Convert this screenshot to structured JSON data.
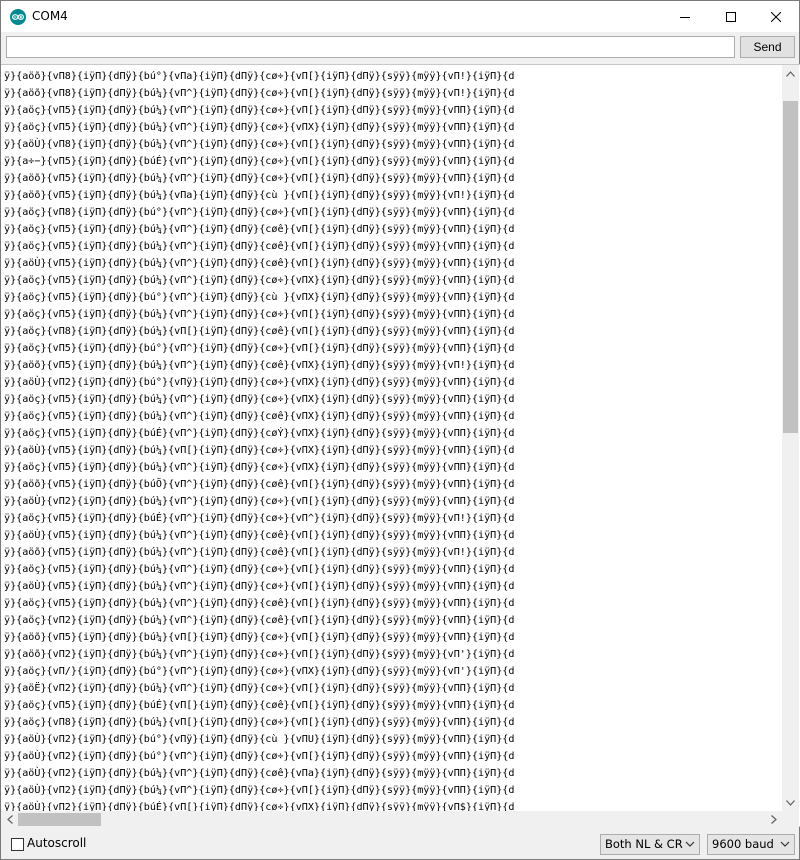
{
  "window": {
    "title": "COM4",
    "app_icon": "arduino-logo-icon",
    "controls": [
      "minimize-icon",
      "maximize-icon",
      "close-icon"
    ]
  },
  "send_bar": {
    "input_value": "",
    "send_label": "Send"
  },
  "output": {
    "lines": [
      "ÿ}{aöõ}{vΠ8}{iÿΠ}{dΠÿ}{bú°}{vΠa}{iÿΠ}{dΠÿ}{cø÷}{vΠ[}{iÿΠ}{dΠÿ}{sÿÿ}{mÿÿ}{vΠ!}{iÿΠ}{d",
      "ÿ}{aöõ}{vΠ8}{iÿΠ}{dΠÿ}{bú¼}{vΠ^}{iÿΠ}{dΠÿ}{cø÷}{vΠ[}{iÿΠ}{dΠÿ}{sÿÿ}{mÿÿ}{vΠ!}{iÿΠ}{d",
      "ÿ}{aöç}{vΠ5}{iÿΠ}{dΠÿ}{bú¼}{vΠ^}{iÿΠ}{dΠÿ}{cø÷}{vΠ[}{iÿΠ}{dΠÿ}{sÿÿ}{mÿÿ}{vΠΠ}{iÿΠ}{d",
      "ÿ}{aöç}{vΠ5}{iÿΠ}{dΠÿ}{bú¼}{vΠ^}{iÿΠ}{dΠÿ}{cø÷}{vΠX}{iÿΠ}{dΠÿ}{sÿÿ}{mÿÿ}{vΠΠ}{iÿΠ}{d",
      "ÿ}{aöÙ}{vΠ8}{iÿΠ}{dΠÿ}{bú¼}{vΠ^}{iÿΠ}{dΠÿ}{cø÷}{vΠ[}{iÿΠ}{dΠÿ}{sÿÿ}{mÿÿ}{vΠΠ}{iÿΠ}{d",
      "ÿ}{a÷−}{vΠ5}{iÿΠ}{dΠÿ}{búÉ}{vΠ^}{iÿΠ}{dΠÿ}{cø÷}{vΠ[}{iÿΠ}{dΠÿ}{sÿÿ}{mÿÿ}{vΠΠ}{iÿΠ}{d",
      "ÿ}{aöõ}{vΠ5}{iÿΠ}{dΠÿ}{bú¼}{vΠ^}{iÿΠ}{dΠÿ}{cø÷}{vΠ[}{iÿΠ}{dΠÿ}{sÿÿ}{mÿÿ}{vΠΠ}{iÿΠ}{d",
      "ÿ}{aöõ}{vΠ5}{iÿΠ}{dΠÿ}{bú¼}{vΠa}{iÿΠ}{dΠÿ}{cù }{vΠ[}{iÿΠ}{dΠÿ}{sÿÿ}{mÿÿ}{vΠ!}{iÿΠ}{d",
      "ÿ}{aöç}{vΠ8}{iÿΠ}{dΠÿ}{bú°}{vΠ^}{iÿΠ}{dΠÿ}{cø÷}{vΠ[}{iÿΠ}{dΠÿ}{sÿÿ}{mÿÿ}{vΠΠ}{iÿΠ}{d",
      "ÿ}{aöç}{vΠ5}{iÿΠ}{dΠÿ}{bú¼}{vΠ^}{iÿΠ}{dΠÿ}{cøê}{vΠ[}{iÿΠ}{dΠÿ}{sÿÿ}{mÿÿ}{vΠΠ}{iÿΠ}{d",
      "ÿ}{aöç}{vΠ5}{iÿΠ}{dΠÿ}{bú¼}{vΠ^}{iÿΠ}{dΠÿ}{cøê}{vΠ[}{iÿΠ}{dΠÿ}{sÿÿ}{mÿÿ}{vΠΠ}{iÿΠ}{d",
      "ÿ}{aöÙ}{vΠ5}{iÿΠ}{dΠÿ}{bú¼}{vΠ^}{iÿΠ}{dΠÿ}{cøê}{vΠ[}{iÿΠ}{dΠÿ}{sÿÿ}{mÿÿ}{vΠΠ}{iÿΠ}{d",
      "ÿ}{aöç}{vΠ5}{iÿΠ}{dΠÿ}{bú¼}{vΠ^}{iÿΠ}{dΠÿ}{cø÷}{vΠX}{iÿΠ}{dΠÿ}{sÿÿ}{mÿÿ}{vΠΠ}{iÿΠ}{d",
      "ÿ}{aöç}{vΠ5}{iÿΠ}{dΠÿ}{bú°}{vΠ^}{iÿΠ}{dΠÿ}{cù }{vΠX}{iÿΠ}{dΠÿ}{sÿÿ}{mÿÿ}{vΠΠ}{iÿΠ}{d",
      "ÿ}{aöç}{vΠ5}{iÿΠ}{dΠÿ}{bú¼}{vΠ^}{iÿΠ}{dΠÿ}{cø÷}{vΠ[}{iÿΠ}{dΠÿ}{sÿÿ}{mÿÿ}{vΠΠ}{iÿΠ}{d",
      "ÿ}{aöç}{vΠ8}{iÿΠ}{dΠÿ}{bú¼}{vΠ[}{iÿΠ}{dΠÿ}{cøê}{vΠ[}{iÿΠ}{dΠÿ}{sÿÿ}{mÿÿ}{vΠΠ}{iÿΠ}{d",
      "ÿ}{aöç}{vΠ5}{iÿΠ}{dΠÿ}{bú°}{vΠ^}{iÿΠ}{dΠÿ}{cø÷}{vΠ[}{iÿΠ}{dΠÿ}{sÿÿ}{mÿÿ}{vΠΠ}{iÿΠ}{d",
      "ÿ}{aöõ}{vΠ5}{iÿΠ}{dΠÿ}{bú¼}{vΠ^}{iÿΠ}{dΠÿ}{cøê}{vΠX}{iÿΠ}{dΠÿ}{sÿÿ}{mÿÿ}{vΠ!}{iÿΠ}{d",
      "ÿ}{aöÙ}{vΠ2}{iÿΠ}{dΠÿ}{bú°}{vΠÿ}{iÿΠ}{dΠÿ}{cø÷}{vΠX}{iÿΠ}{dΠÿ}{sÿÿ}{mÿÿ}{vΠΠ}{iÿΠ}{d",
      "ÿ}{aöç}{vΠ5}{iÿΠ}{dΠÿ}{bú¼}{vΠ^}{iÿΠ}{dΠÿ}{cø÷}{vΠX}{iÿΠ}{dΠÿ}{sÿÿ}{mÿÿ}{vΠΠ}{iÿΠ}{d",
      "ÿ}{aöç}{vΠ5}{iÿΠ}{dΠÿ}{bú¼}{vΠ^}{iÿΠ}{dΠÿ}{cøê}{vΠX}{iÿΠ}{dΠÿ}{sÿÿ}{mÿÿ}{vΠΠ}{iÿΠ}{d",
      "ÿ}{aöç}{vΠ5}{iÿΠ}{dΠÿ}{búÉ}{vΠ^}{iÿΠ}{dΠÿ}{cøÝ}{vΠX}{iÿΠ}{dΠÿ}{sÿÿ}{mÿÿ}{vΠΠ}{iÿΠ}{d",
      "ÿ}{aöÙ}{vΠ5}{iÿΠ}{dΠÿ}{bú¼}{vΠ[}{iÿΠ}{dΠÿ}{cø÷}{vΠX}{iÿΠ}{dΠÿ}{sÿÿ}{mÿÿ}{vΠΠ}{iÿΠ}{d",
      "ÿ}{aöç}{vΠ5}{iÿΠ}{dΠÿ}{bú¼}{vΠ^}{iÿΠ}{dΠÿ}{cø÷}{vΠX}{iÿΠ}{dΠÿ}{sÿÿ}{mÿÿ}{vΠΠ}{iÿΠ}{d",
      "ÿ}{aöõ}{vΠ5}{iÿΠ}{dΠÿ}{búÕ}{vΠ^}{iÿΠ}{dΠÿ}{cøê}{vΠ[}{iÿΠ}{dΠÿ}{sÿÿ}{mÿÿ}{vΠΠ}{iÿΠ}{d",
      "ÿ}{aöÙ}{vΠ2}{iÿΠ}{dΠÿ}{bú¼}{vΠ^}{iÿΠ}{dΠÿ}{cø÷}{vΠ[}{iÿΠ}{dΠÿ}{sÿÿ}{mÿÿ}{vΠΠ}{iÿΠ}{d",
      "ÿ}{aöç}{vΠ5}{iÿΠ}{dΠÿ}{búÉ}{vΠ^}{iÿΠ}{dΠÿ}{cø÷}{vΠ^}{iÿΠ}{dΠÿ}{sÿÿ}{mÿÿ}{vΠ!}{iÿΠ}{d",
      "ÿ}{aöÙ}{vΠ5}{iÿΠ}{dΠÿ}{bú¼}{vΠ^}{iÿΠ}{dΠÿ}{cøê}{vΠ[}{iÿΠ}{dΠÿ}{sÿÿ}{mÿÿ}{vΠΠ}{iÿΠ}{d",
      "ÿ}{aöõ}{vΠ5}{iÿΠ}{dΠÿ}{bú¼}{vΠ^}{iÿΠ}{dΠÿ}{cøê}{vΠ[}{iÿΠ}{dΠÿ}{sÿÿ}{mÿÿ}{vΠ!}{iÿΠ}{d",
      "ÿ}{aöç}{vΠ5}{iÿΠ}{dΠÿ}{bú¼}{vΠ^}{iÿΠ}{dΠÿ}{cø÷}{vΠ[}{iÿΠ}{dΠÿ}{sÿÿ}{mÿÿ}{vΠΠ}{iÿΠ}{d",
      "ÿ}{aöÙ}{vΠ5}{iÿΠ}{dΠÿ}{bú¼}{vΠ^}{iÿΠ}{dΠÿ}{cø÷}{vΠ[}{iÿΠ}{dΠÿ}{sÿÿ}{mÿÿ}{vΠΠ}{iÿΠ}{d",
      "ÿ}{aöç}{vΠ5}{iÿΠ}{dΠÿ}{bú¼}{vΠ^}{iÿΠ}{dΠÿ}{cøê}{vΠ[}{iÿΠ}{dΠÿ}{sÿÿ}{mÿÿ}{vΠΠ}{iÿΠ}{d",
      "ÿ}{aöç}{vΠ2}{iÿΠ}{dΠÿ}{bú¼}{vΠ^}{iÿΠ}{dΠÿ}{cøê}{vΠ[}{iÿΠ}{dΠÿ}{sÿÿ}{mÿÿ}{vΠΠ}{iÿΠ}{d",
      "ÿ}{aöõ}{vΠ5}{iÿΠ}{dΠÿ}{bú¼}{vΠ[}{iÿΠ}{dΠÿ}{cø÷}{vΠ[}{iÿΠ}{dΠÿ}{sÿÿ}{mÿÿ}{vΠΠ}{iÿΠ}{d",
      "ÿ}{aöõ}{vΠ2}{iÿΠ}{dΠÿ}{bú¼}{vΠ^}{iÿΠ}{dΠÿ}{cø÷}{vΠ[}{iÿΠ}{dΠÿ}{sÿÿ}{mÿÿ}{vΠ'}{iÿΠ}{d",
      "ÿ}{aöç}{vΠ/}{iÿΠ}{dΠÿ}{bú°}{vΠ^}{iÿΠ}{dΠÿ}{cø÷}{vΠX}{iÿΠ}{dΠÿ}{sÿÿ}{mÿÿ}{vΠ'}{iÿΠ}{d",
      "ÿ}{aöË}{vΠ2}{iÿΠ}{dΠÿ}{bú¼}{vΠ^}{iÿΠ}{dΠÿ}{cø÷}{vΠ[}{iÿΠ}{dΠÿ}{sÿÿ}{mÿÿ}{vΠΠ}{iÿΠ}{d",
      "ÿ}{aöç}{vΠ5}{iÿΠ}{dΠÿ}{búÉ}{vΠ[}{iÿΠ}{dΠÿ}{cøê}{vΠ[}{iÿΠ}{dΠÿ}{sÿÿ}{mÿÿ}{vΠΠ}{iÿΠ}{d",
      "ÿ}{aöç}{vΠ8}{iÿΠ}{dΠÿ}{bú¼}{vΠ[}{iÿΠ}{dΠÿ}{cø÷}{vΠ[}{iÿΠ}{dΠÿ}{sÿÿ}{mÿÿ}{vΠΠ}{iÿΠ}{d",
      "ÿ}{aöÙ}{vΠ2}{iÿΠ}{dΠÿ}{bú°}{vΠÿ}{iÿΠ}{dΠÿ}{cù }{vΠU}{iÿΠ}{dΠÿ}{sÿÿ}{mÿÿ}{vΠΠ}{iÿΠ}{d",
      "ÿ}{aöÙ}{vΠ2}{iÿΠ}{dΠÿ}{bú°}{vΠ^}{iÿΠ}{dΠÿ}{cø÷}{vΠ[}{iÿΠ}{dΠÿ}{sÿÿ}{mÿÿ}{vΠΠ}{iÿΠ}{d",
      "ÿ}{aöÙ}{vΠ2}{iÿΠ}{dΠÿ}{bú¼}{vΠ^}{iÿΠ}{dΠÿ}{cøê}{vΠa}{iÿΠ}{dΠÿ}{sÿÿ}{mÿÿ}{vΠΠ}{iÿΠ}{d",
      "ÿ}{aöÙ}{vΠ2}{iÿΠ}{dΠÿ}{bú¼}{vΠ^}{iÿΠ}{dΠÿ}{cø÷}{vΠ[}{iÿΠ}{dΠÿ}{sÿÿ}{mÿÿ}{vΠΠ}{iÿΠ}{d",
      "ÿ}{aöÙ}{vΠ2}{iÿΠ}{dΠÿ}{búÉ}{vΠ[}{iÿΠ}{dΠÿ}{cø÷}{vΠX}{iÿΠ}{dΠÿ}{sÿÿ}{mÿÿ}{vΠ$}{iÿΠ}{d"
    ]
  },
  "footer": {
    "autoscroll_label": "Autoscroll",
    "autoscroll_checked": false,
    "line_ending_value": "Both NL & CR",
    "baud_value": "9600 baud"
  }
}
